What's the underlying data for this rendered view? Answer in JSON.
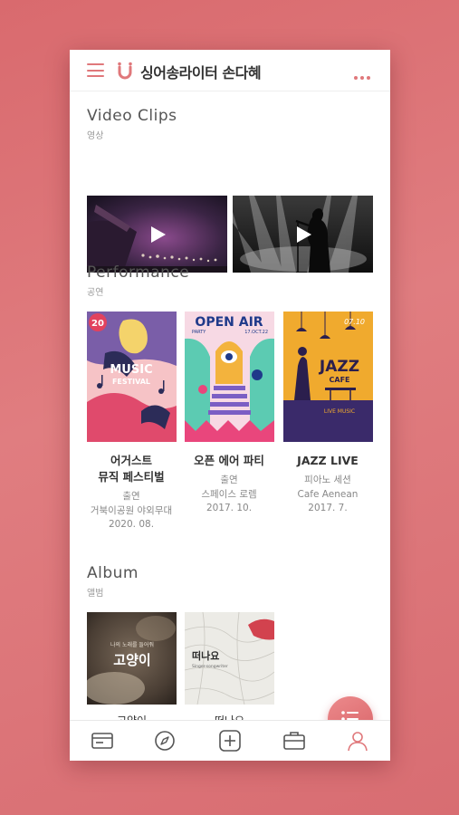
{
  "header": {
    "title": "싱어송라이터 손다혜",
    "menu_icon": "hamburger-icon",
    "more_icon": "more-dots-icon"
  },
  "video_section": {
    "title": "Video Clips",
    "subtitle": "영상",
    "items": [
      {
        "icon": "play-icon"
      },
      {
        "icon": "play-icon"
      }
    ]
  },
  "performance_section": {
    "title": "Performance",
    "subtitle": "공연",
    "items": [
      {
        "title_line1": "어거스트",
        "title_line2": "뮤직 페스티벌",
        "role": "출연",
        "venue": "거북이공원 야외무대",
        "date": "2020. 08.",
        "poster": {
          "badge": "20",
          "line1": "MUSIC",
          "line2": "FESTIVAL"
        }
      },
      {
        "title_line1": "오픈 에어 파티",
        "role": "출연",
        "venue": "스페이스 로렘",
        "date": "2017. 10.",
        "poster": {
          "headline": "OPEN AIR",
          "tag": "PARTY",
          "date_tag": "17.OCT.22"
        }
      },
      {
        "title_line1": "JAZZ LIVE",
        "role": "피아노 세션",
        "venue": "Cafe Aenean",
        "date": "2017. 7.",
        "poster": {
          "date_tag": "07.10",
          "line1": "JAZZ",
          "line2": "CAFE",
          "line3": "LIVE MUSIC"
        }
      }
    ]
  },
  "album_section": {
    "title": "Album",
    "subtitle": "앨범",
    "items": [
      {
        "cover_text": "고양이",
        "cover_small": "나의 노래를 들어줘",
        "title": "고양이"
      },
      {
        "cover_text": "떠나요",
        "cover_small": "Singer-songwriter",
        "title": "떠나요"
      }
    ]
  },
  "fab": {
    "icon": "list-menu-icon"
  },
  "tabbar": {
    "tabs": [
      {
        "icon": "card-icon"
      },
      {
        "icon": "compass-icon"
      },
      {
        "icon": "add-square-icon"
      },
      {
        "icon": "briefcase-icon"
      },
      {
        "icon": "profile-icon"
      }
    ],
    "active_color": "#e0787b"
  },
  "colors": {
    "accent": "#e0787b",
    "background": "#da6e72"
  }
}
